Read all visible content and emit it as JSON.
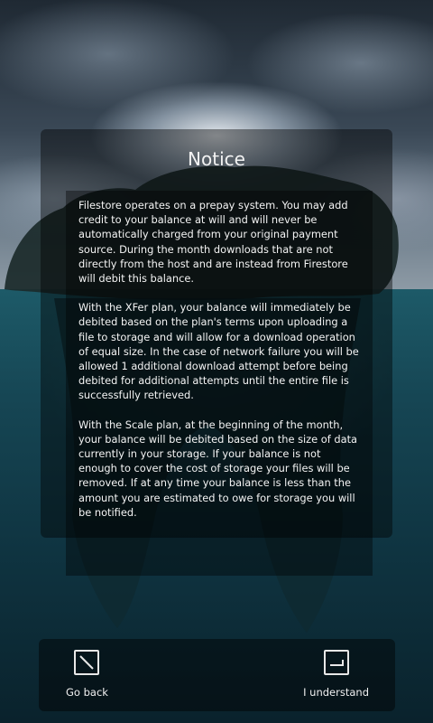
{
  "notice": {
    "title": "Notice",
    "paragraphs": [
      "Filestore operates on a prepay system. You may add credit to your balance at will and will never be automatically charged from your original payment source. During the month downloads that are not directly from the host and are instead from Firestore will debit this balance.",
      "With the XFer plan, your balance will immediately be debited based on the plan's terms upon uploading a file to storage and will allow for a download operation of equal size. In the case of network failure you will be allowed 1 additional download attempt before being debited for additional attempts until the entire file is successfully retrieved.",
      "With the Scale plan, at the beginning of the month, your balance will be debited based on the size of data currently in your storage. If your balance is not enough to cover the cost of storage your files will be removed. If at any time your balance is less than the amount you are estimated to owe for storage you will be notified."
    ]
  },
  "actions": {
    "go_back": {
      "label": "Go back",
      "icon": "back-arrow-icon"
    },
    "understand": {
      "label": "I understand",
      "icon": "enter-arrow-icon"
    }
  }
}
